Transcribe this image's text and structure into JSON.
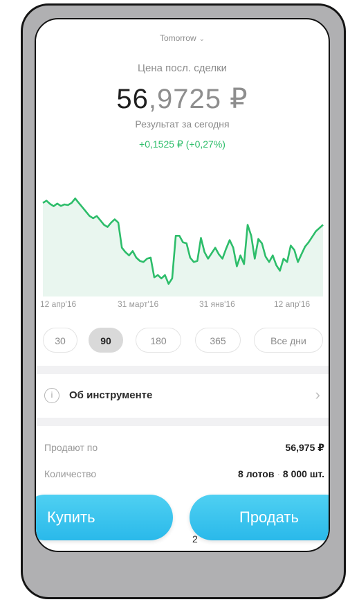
{
  "header": {
    "dropdown_label": "Tomorrow",
    "dropdown_icon": "chevron-down-icon"
  },
  "quote": {
    "last_trade_label": "Цена посл. сделки",
    "price_integer": "56",
    "price_fraction": ",9725",
    "price_currency": " ₽",
    "result_label": "Результат за сегодня",
    "result_change": "+0,1525 ₽ (+0,27%)"
  },
  "chart_data": {
    "type": "area",
    "x_tick_labels": [
      "12 апр'16",
      "31 март'16",
      "31 янв'16",
      "12 апр'16"
    ],
    "values": [
      71.5,
      72.5,
      71,
      70,
      71.2,
      70.1,
      70.8,
      70.5,
      71.5,
      73.5,
      71.5,
      69.5,
      67.5,
      65.5,
      64.5,
      65.5,
      63.5,
      61.5,
      60.5,
      62.5,
      64,
      62.5,
      51,
      49,
      47.5,
      49.5,
      46.5,
      45,
      44.5,
      46,
      46.5,
      37.5,
      38.5,
      37,
      38.5,
      34.5,
      37,
      56.5,
      56.5,
      53.5,
      53,
      46.5,
      44.5,
      45,
      55.5,
      49,
      46,
      48.5,
      51,
      48,
      46,
      50.5,
      54.5,
      51,
      42.5,
      47.5,
      43.5,
      61.5,
      56.5,
      46,
      55,
      53,
      47,
      44.5,
      47.5,
      43,
      40.5,
      46,
      44.5,
      52,
      50,
      44.5,
      48,
      51.5,
      53.5,
      56,
      58.5,
      60,
      61.5
    ],
    "ylim": [
      30,
      80
    ],
    "colors": {
      "line": "#2dbd6a",
      "fill": "#e9f6ef"
    },
    "grid": false
  },
  "periods": {
    "items": [
      "30",
      "90",
      "180",
      "365",
      "Все дни"
    ],
    "active": "90"
  },
  "about": {
    "label": "Об инструменте",
    "icon": "info-icon",
    "chevron": "chevron-right-icon"
  },
  "order_info": {
    "sell_at_label": "Продают по",
    "sell_at_value": "56,975 ₽",
    "quantity_label": "Количество",
    "quantity_lots": "8 лотов",
    "quantity_separator": "·",
    "quantity_shares": "8 000 шт."
  },
  "actions": {
    "buy_label": "Купить",
    "sell_label": "Продать",
    "bottom_fragment": "2"
  },
  "colors": {
    "accent_green": "#2dbd6a",
    "button_blue": "#2ab9ea",
    "frame_gray": "#b0b0b2"
  }
}
